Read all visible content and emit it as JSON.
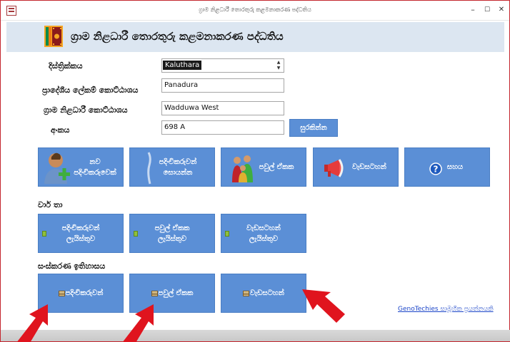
{
  "window": {
    "title": "ග්‍රාම නිළධාරී තොරතුරු කළමනාකරණ පද්ධතිය",
    "minimize": "–",
    "maximize": "☐",
    "close": "✕"
  },
  "header": {
    "app_title": "ග්‍රාම නිළධාරී තොරතුරු කළමනාකරණ පද්ධතිය",
    "flag_icon": "sri-lanka-flag-icon"
  },
  "form": {
    "district_label": "දිස්ත්‍රික්කය",
    "district_value": "Kaluthara",
    "ds_label": "ප්‍රාදේශීය ලේකම් කොට්ඨාශය",
    "ds_value": "Panadura",
    "gn_label": "ග්‍රාම නිළධාරී කොට්ඨාශය",
    "gn_value": "Wadduwa West",
    "number_label": "අංකය",
    "number_value": "698 A",
    "save_button": "සුරකින්න"
  },
  "main_buttons": [
    {
      "label": "නව\nපදිංචිකරුවෙක්",
      "icon": "add-user-icon"
    },
    {
      "label": "පදිංචිකරුවන්\nසොයන්න",
      "icon": "search-person-icon"
    },
    {
      "label": "පවුල් ඒකක",
      "icon": "family-icon"
    },
    {
      "label": "වැඩසටහන්",
      "icon": "megaphone-icon"
    },
    {
      "label": "සහය",
      "icon": "help-icon"
    }
  ],
  "reports": {
    "label": "වාර් තා",
    "buttons": [
      {
        "label": "පදිංචිකරුවන්\nලැයිස්තුව",
        "icon": "document-icon"
      },
      {
        "label": "පවුල් ඒකක\nලැයිස්තුව",
        "icon": "document-icon"
      },
      {
        "label": "වැඩසටහන්\nලැයිස්තුව",
        "icon": "document-icon"
      }
    ]
  },
  "history": {
    "label": "සංස්කරණ ඉතිහාසය",
    "buttons": [
      {
        "label": "පදිංචිකරුවන්",
        "icon": "table-icon"
      },
      {
        "label": "පවුල් ඒකක",
        "icon": "table-icon"
      },
      {
        "label": "වැඩසටහන්",
        "icon": "table-icon"
      }
    ]
  },
  "footer": {
    "link": "GenoTechies සාමූහික ප්‍රයත්නයකි"
  },
  "colors": {
    "button_blue": "#5b8fd6",
    "header_bg": "#dce6f1",
    "arrow_red": "#e0141e",
    "link_blue": "#1a44c8"
  }
}
